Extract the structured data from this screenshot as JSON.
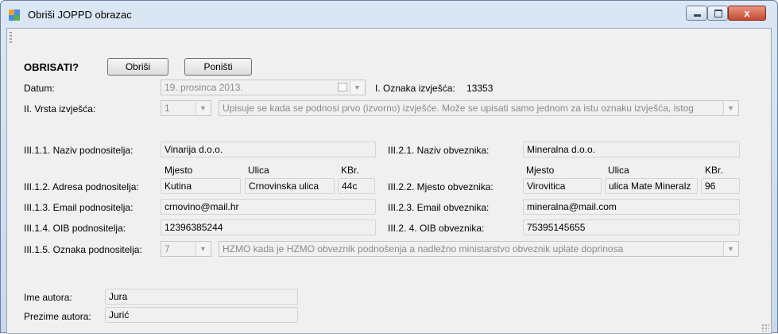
{
  "window": {
    "title": "Obriši JOPPD obrazac",
    "minimize": "",
    "maximize": "",
    "close": "x"
  },
  "header": {
    "prompt": "OBRISATI?",
    "delete_label": "Obriši",
    "cancel_label": "Poništi"
  },
  "datum": {
    "label": "Datum:",
    "value": "19. prosinca 2013."
  },
  "oznaka": {
    "label": "I. Oznaka izvješća:",
    "value": "13353"
  },
  "vrsta": {
    "label": "II. Vrsta izvješća:",
    "code": "1",
    "description": "Upisuje se kada se podnosi prvo (izvorno) izvješće. Može se upisati samo jednom za istu oznaku izvješća, istog"
  },
  "podnositelj": {
    "naziv_label": "III.1.1. Naziv podnositelja:",
    "naziv": "Vinarija d.o.o.",
    "mjesto_header": "Mjesto",
    "ulica_header": "Ulica",
    "kbr_header": "KBr.",
    "adresa_label": "III.1.2. Adresa podnositelja:",
    "mjesto": "Kutina",
    "ulica": "Crnovinska ulica",
    "kbr": "44c",
    "email_label": "III.1.3. Email podnositelja:",
    "email": "crnovino@mail.hr",
    "oib_label": "III.1.4. OIB podnositelja:",
    "oib": "12396385244",
    "oznaka_label": "III.1.5. Oznaka podnositelja:",
    "oznaka_code": "7",
    "oznaka_desc": "HZMO kada je HZMO obveznik podnošenja a nadležno ministarstvo obveznik uplate doprinosa"
  },
  "obveznik": {
    "naziv_label": "III.2.1. Naziv obveznika:",
    "naziv": "Mineralna d.o.o.",
    "mjesto_header": "Mjesto",
    "ulica_header": "Ulica",
    "kbr_header": "KBr.",
    "mjesto_label": "III.2.2. Mjesto obveznika:",
    "mjesto": "Virovitica",
    "ulica": "ulica Mate Mineralz",
    "kbr": "96",
    "email_label": "III.2.3. Email obveznika:",
    "email": "mineralna@mail.com",
    "oib_label": "III.2. 4. OIB obveznika:",
    "oib": "75395145655"
  },
  "autor": {
    "ime_label": "Ime autora:",
    "ime": "Jura",
    "prezime_label": "Prezime autora:",
    "prezime": "Jurić"
  }
}
